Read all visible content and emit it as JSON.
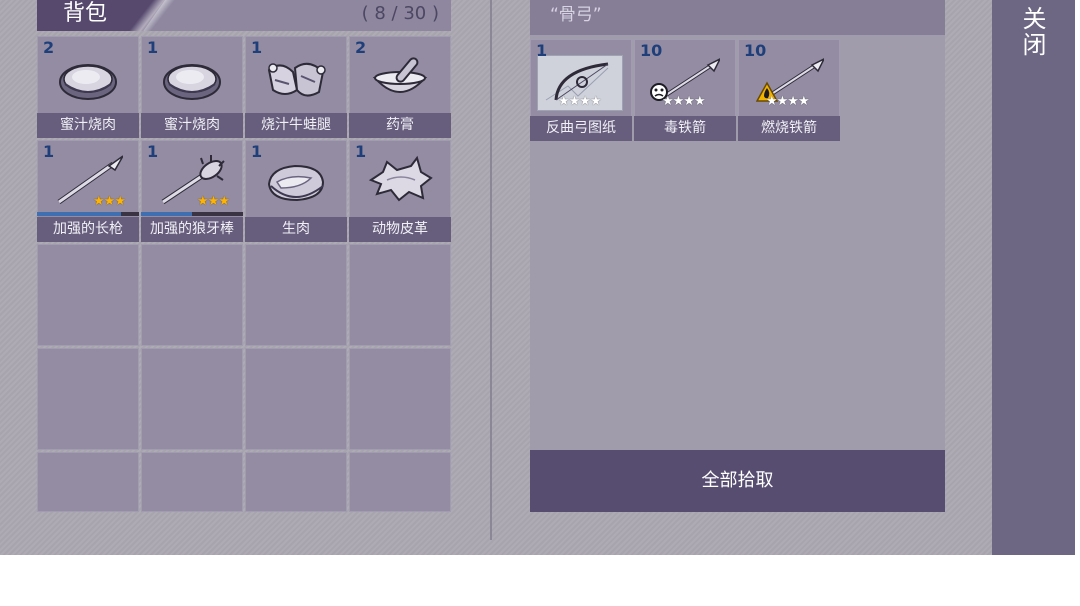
{
  "backpack": {
    "title": "背包",
    "capacity": "( 8 / 30 )",
    "items": [
      {
        "qty": "2",
        "name": "蜜汁烧肉",
        "icon": "meat-chunk-icon"
      },
      {
        "qty": "1",
        "name": "蜜汁烧肉",
        "icon": "meat-chunk-icon"
      },
      {
        "qty": "1",
        "name": "烧汁牛蛙腿",
        "icon": "frog-legs-icon"
      },
      {
        "qty": "2",
        "name": "药膏",
        "icon": "mortar-pestle-icon"
      },
      {
        "qty": "1",
        "name": "加强的长枪",
        "icon": "spear-icon",
        "stars": "★★★",
        "durability": 0.82
      },
      {
        "qty": "1",
        "name": "加强的狼牙棒",
        "icon": "mace-icon",
        "stars": "★★★",
        "durability": 0.5
      },
      {
        "qty": "1",
        "name": "生肉",
        "icon": "raw-meat-icon"
      },
      {
        "qty": "1",
        "name": "动物皮革",
        "icon": "animal-hide-icon"
      }
    ]
  },
  "loot": {
    "title": "“骨弓”",
    "items": [
      {
        "qty": "1",
        "name": "反曲弓图纸",
        "icon": "bow-blueprint-icon",
        "stars": "★★★★"
      },
      {
        "qty": "10",
        "name": "毒铁箭",
        "icon": "poison-arrow-icon",
        "stars": "★★★★",
        "badge": "poison-skull-icon"
      },
      {
        "qty": "10",
        "name": "燃烧铁箭",
        "icon": "fire-arrow-icon",
        "stars": "★★★★",
        "badge": "fire-warning-icon"
      }
    ],
    "pickup_all_label": "全部拾取"
  },
  "close_label": "关闭",
  "colors": {
    "panel": "#938ca3",
    "label_bg": "#675e7d",
    "button": "#574d70",
    "qty_text": "#1f3f7a",
    "star_gold": "#ffb400",
    "durability": "#3f6fb0"
  }
}
